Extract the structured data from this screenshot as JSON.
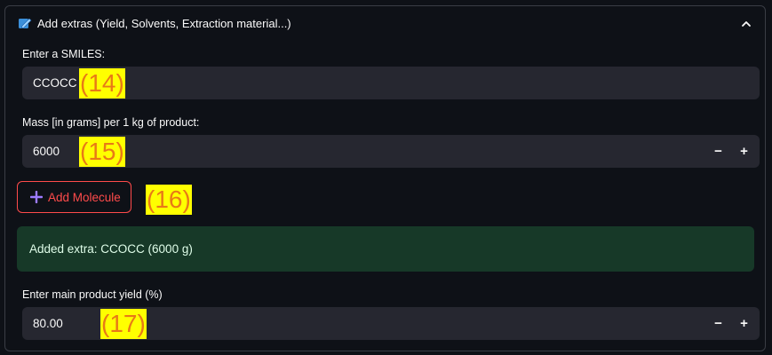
{
  "expander": {
    "title": "Add extras (Yield, Solvents, Extraction material...)",
    "icon": "write-icon",
    "chevron": "chevron-up-icon"
  },
  "smiles": {
    "label": "Enter a SMILES:",
    "value": "CCOCC",
    "annotation": "(14)"
  },
  "mass": {
    "label": "Mass [in grams] per 1 kg of product:",
    "value": "6000",
    "minus": "−",
    "plus": "+",
    "annotation": "(15)"
  },
  "add_button": {
    "label": "Add Molecule",
    "icon": "plus-icon",
    "annotation": "(16)"
  },
  "success": {
    "message": "Added extra: CCOCC (6000 g)"
  },
  "yield": {
    "label": "Enter main product yield (%)",
    "value": "80.00",
    "minus": "−",
    "plus": "+",
    "annotation": "(17)"
  },
  "colors": {
    "accent": "#ff4b4b",
    "success_bg": "#173928",
    "input_bg": "#262730",
    "icon_purple": "#7b61ff"
  }
}
